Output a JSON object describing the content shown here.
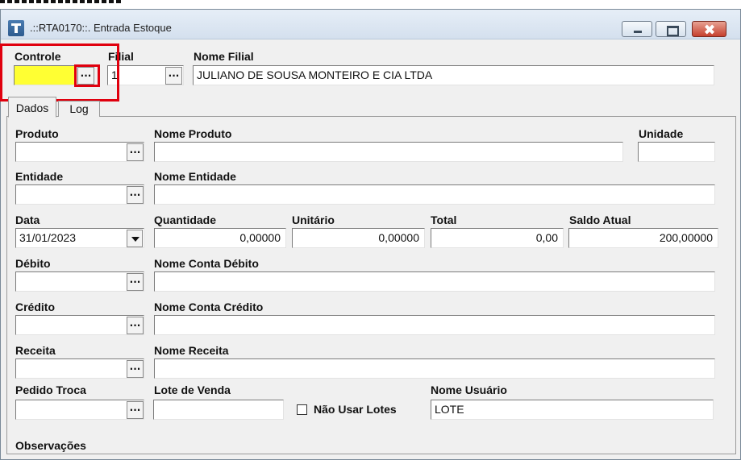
{
  "window": {
    "title": ".::RTA0170::. Entrada Estoque"
  },
  "header": {
    "controle_label": "Controle",
    "controle_value": "",
    "filial_label": "Filial",
    "filial_value": "1",
    "nome_filial_label": "Nome Filial",
    "nome_filial_value": "JULIANO DE SOUSA MONTEIRO E CIA LTDA"
  },
  "tabs": [
    {
      "label": "Dados"
    },
    {
      "label": "Log"
    }
  ],
  "form": {
    "produto_label": "Produto",
    "produto_value": "",
    "nome_produto_label": "Nome Produto",
    "nome_produto_value": "",
    "unidade_label": "Unidade",
    "unidade_value": "",
    "entidade_label": "Entidade",
    "entidade_value": "",
    "nome_entidade_label": "Nome Entidade",
    "nome_entidade_value": "",
    "data_label": "Data",
    "data_value": "31/01/2023",
    "quantidade_label": "Quantidade",
    "quantidade_value": "0,00000",
    "unitario_label": "Unitário",
    "unitario_value": "0,00000",
    "total_label": "Total",
    "total_value": "0,00",
    "saldo_label": "Saldo Atual",
    "saldo_value": "200,00000",
    "debito_label": "Débito",
    "debito_value": "",
    "nome_conta_debito_label": "Nome Conta Débito",
    "nome_conta_debito_value": "",
    "credito_label": "Crédito",
    "credito_value": "",
    "nome_conta_credito_label": "Nome Conta Crédito",
    "nome_conta_credito_value": "",
    "receita_label": "Receita",
    "receita_value": "",
    "nome_receita_label": "Nome Receita",
    "nome_receita_value": "",
    "pedido_troca_label": "Pedido Troca",
    "pedido_troca_value": "",
    "lote_venda_label": "Lote de Venda",
    "lote_venda_value": "",
    "nao_usar_lotes_label": "Não Usar Lotes",
    "nao_usar_lotes_checked": false,
    "nome_usuario_label": "Nome Usuário",
    "nome_usuario_value": "LOTE",
    "observacoes_label": "Observações"
  },
  "ellipsis_glyph": "...",
  "colors": {
    "controle_highlight": "#ffff33",
    "annotation_red": "#e0000e"
  }
}
